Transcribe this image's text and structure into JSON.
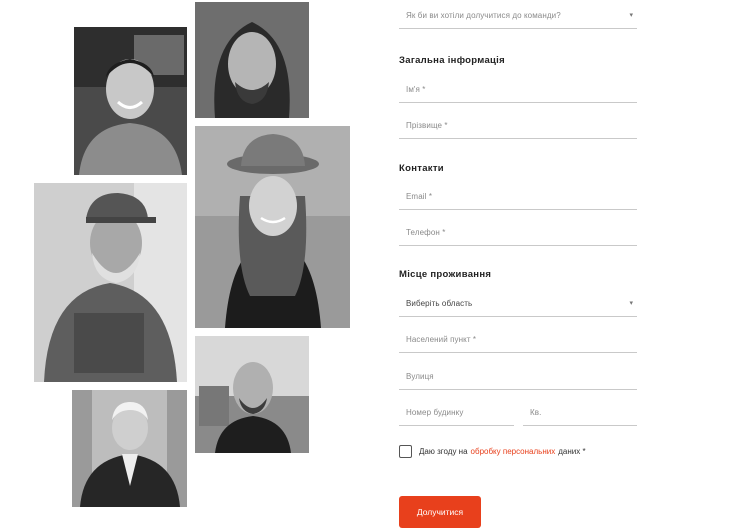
{
  "form": {
    "join_select": {
      "placeholder": "Як би ви хотіли долучитися до команди?"
    },
    "general_info_title": "Загальна інформація",
    "name_field": {
      "placeholder": "Ім'я *"
    },
    "surname_field": {
      "placeholder": "Прізвище *"
    },
    "contacts_title": "Контакти",
    "email_field": {
      "placeholder": "Email *"
    },
    "phone_field": {
      "placeholder": "Телефон *"
    },
    "residence_title": "Місце проживання",
    "region_select": {
      "placeholder": "Виберіть область"
    },
    "locality_field": {
      "placeholder": "Населений пункт *"
    },
    "street_field": {
      "placeholder": "Вулиця"
    },
    "house_field": {
      "placeholder": "Номер будинку"
    },
    "apartment_field": {
      "placeholder": "Кв."
    },
    "consent": {
      "prefix": "Даю згоду на",
      "link": "обробку персональних",
      "suffix": "даних *"
    },
    "submit_label": "Долучитися"
  },
  "colors": {
    "accent": "#e8401c",
    "divider": "#c9c9c9",
    "placeholder": "#8a8a8a"
  },
  "icons": {
    "dropdown": "chevron-down-icon"
  },
  "collage": {
    "photos": [
      "portrait-smiling-man",
      "portrait-long-hair-man",
      "portrait-woman-panama-hat",
      "portrait-older-man-cap",
      "portrait-bald-man",
      "portrait-man-in-suit"
    ]
  }
}
